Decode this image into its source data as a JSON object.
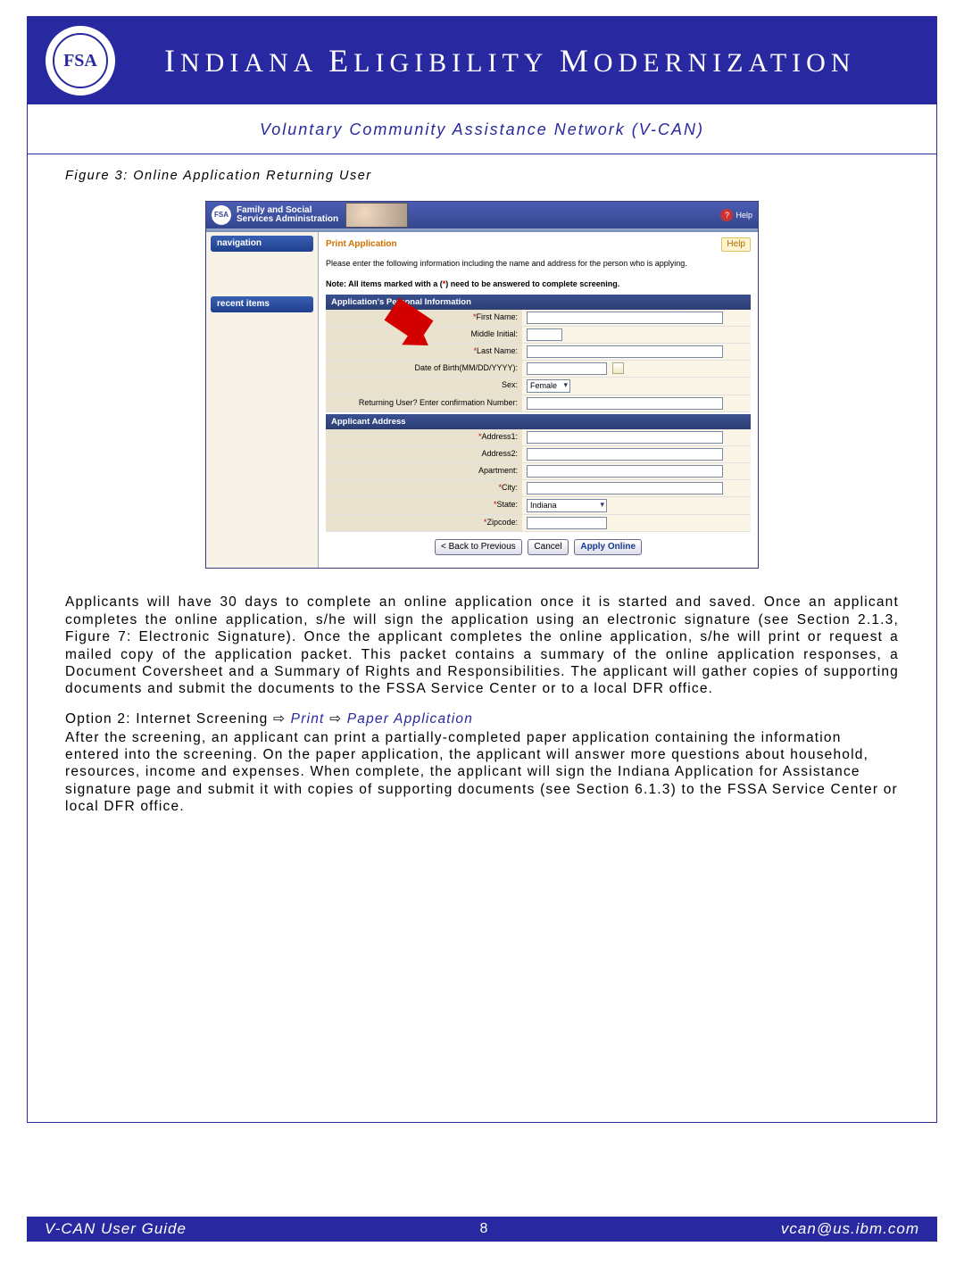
{
  "header": {
    "title_part1": "I",
    "title_part2": "NDIANA ",
    "title_part3": "E",
    "title_part4": "LIGIBILITY ",
    "title_part5": "M",
    "title_part6": "ODERNIZATION",
    "logo_short": "FSA"
  },
  "subheader": "Voluntary Community Assistance Network (V-CAN)",
  "figure_caption": "Figure 3:  Online Application Returning User",
  "screenshot": {
    "top_title_line1": "Family and Social",
    "top_title_line2": "Services Administration",
    "top_help_icon": "?",
    "top_help_text": "Help",
    "nav": {
      "item1": "navigation",
      "item2": "recent items"
    },
    "section": {
      "title": "Print Application",
      "help": "Help",
      "note_text": "Please enter the following information including the name and address for the person who is applying.",
      "note_required_prefix": "Note: All items marked with a (",
      "note_required_star": "*",
      "note_required_suffix": ") need to be answered to complete screening.",
      "sub1": "Application's Personal Information",
      "sub2": "Applicant Address",
      "fields": {
        "first_name": "First Name:",
        "middle_initial": "Middle Initial:",
        "last_name": "Last Name:",
        "dob": "Date of Birth(MM/DD/YYYY):",
        "sex": "Sex:",
        "sex_value": "Female",
        "returning": "Returning User? Enter confirmation Number:",
        "address1": "Address1:",
        "address2": "Address2:",
        "apartment": "Apartment:",
        "city": "City:",
        "state": "State:",
        "state_value": "Indiana",
        "zip": "Zipcode:"
      },
      "buttons": {
        "back": "< Back to Previous",
        "cancel": "Cancel",
        "apply": "Apply Online"
      }
    }
  },
  "para1": "Applicants will have 30 days to complete an online application once it is started and saved. Once an applicant completes the online application, s/he will sign the application using an electronic signature (see Section 2.1.3, Figure 7: Electronic Signature).  Once the applicant completes the online application, s/he will print or request a mailed copy of the application packet. This packet contains a summary of the online application responses, a Document Coversheet and a Summary of Rights and Responsibilities. The applicant will gather copies of supporting documents and submit the documents to the FSSA Service Center or to a local DFR office.",
  "option2": {
    "prefix": "Option 2:  Internet Screening ",
    "arrow": "⇨",
    "mid1": " Print ",
    "mid2": " Paper Application"
  },
  "para2": "After the screening, an applicant can print a partially-completed paper application containing the information entered into the screening.  On the paper application, the applicant will answer more questions about household, resources, income and expenses. When complete, the applicant will sign the Indiana Application for Assistance signature page and submit it with copies of supporting documents (see Section 6.1.3) to the FSSA Service Center or local DFR office.",
  "footer": {
    "left": "V-CAN User Guide",
    "center": "8",
    "right": "vcan@us.ibm.com"
  }
}
